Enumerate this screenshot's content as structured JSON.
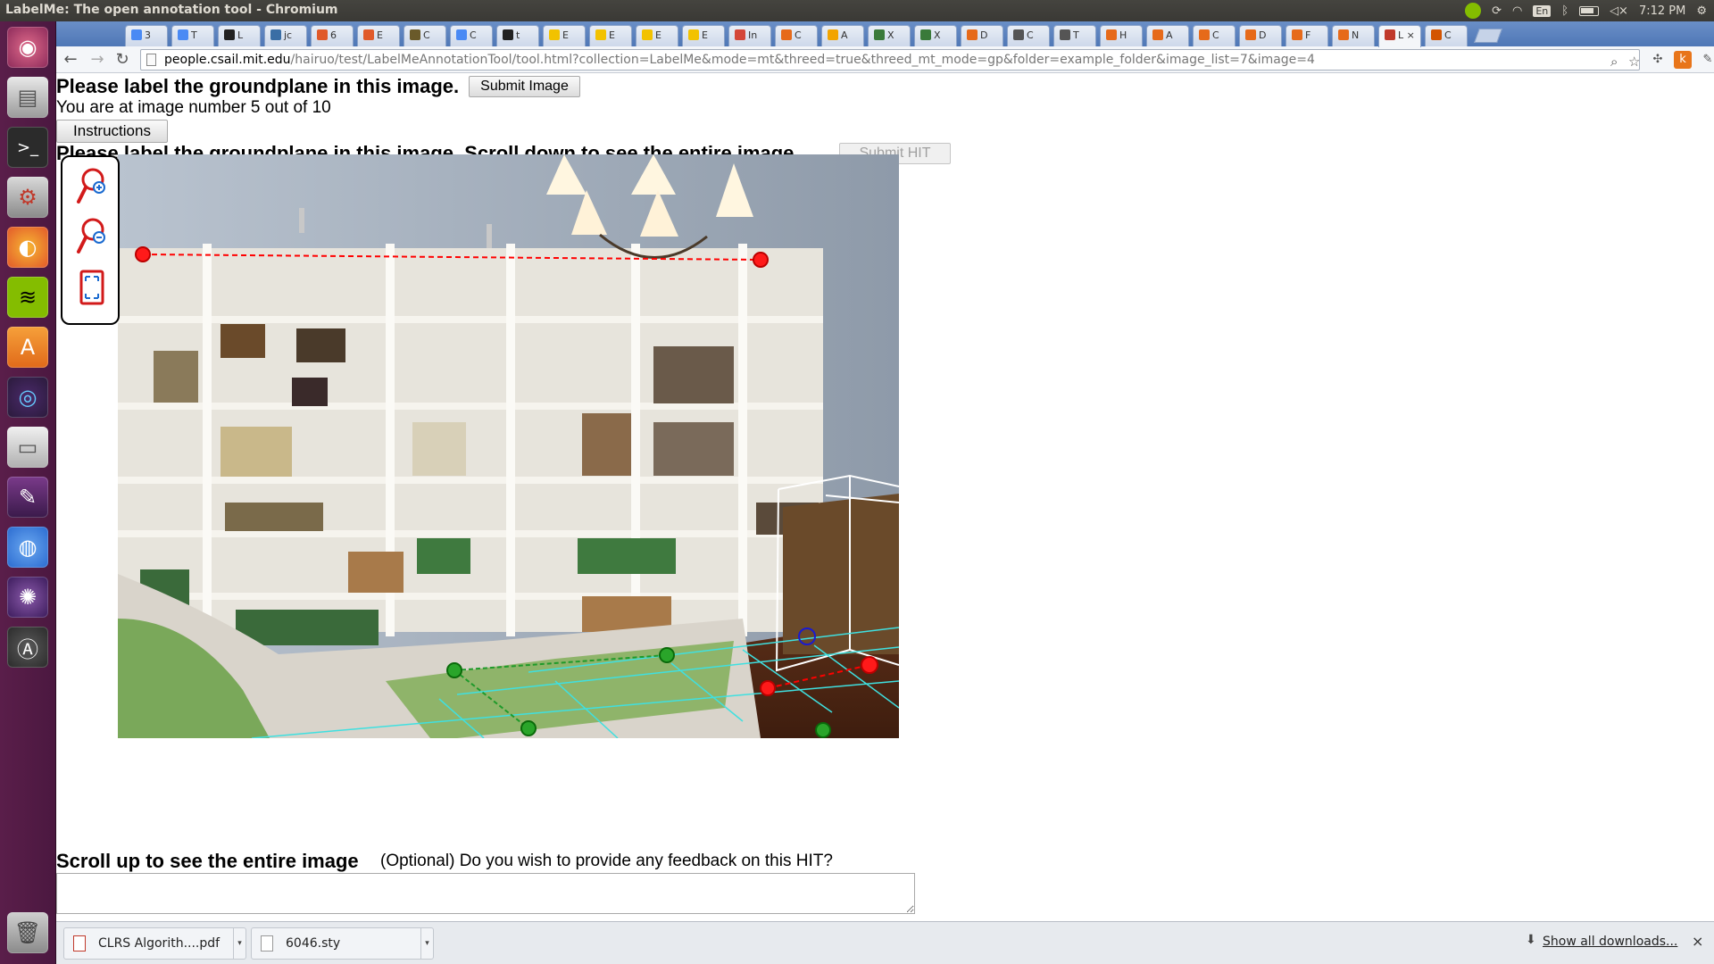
{
  "window": {
    "title": "LabelMe: The open annotation tool - Chromium"
  },
  "tray": {
    "lang": "En",
    "time": "7:12 PM"
  },
  "tabs": [
    {
      "label": "3",
      "color": "#4a8af4"
    },
    {
      "label": "T",
      "color": "#4a8af4"
    },
    {
      "label": "L",
      "color": "#222222"
    },
    {
      "label": "jc",
      "color": "#3a6ea5"
    },
    {
      "label": "6",
      "color": "#e05a2a"
    },
    {
      "label": "E",
      "color": "#e05a2a"
    },
    {
      "label": "C",
      "color": "#6a5a2a"
    },
    {
      "label": "C",
      "color": "#4a8af4"
    },
    {
      "label": "t",
      "color": "#222222"
    },
    {
      "label": "E",
      "color": "#f2c200"
    },
    {
      "label": "E",
      "color": "#f2c200"
    },
    {
      "label": "E",
      "color": "#f2c200"
    },
    {
      "label": "E",
      "color": "#f2c200"
    },
    {
      "label": "In",
      "color": "#d44638"
    },
    {
      "label": "C",
      "color": "#e66a1a"
    },
    {
      "label": "A",
      "color": "#f2a400"
    },
    {
      "label": "X",
      "color": "#3a7a3a"
    },
    {
      "label": "X",
      "color": "#3a7a3a"
    },
    {
      "label": "D",
      "color": "#e66a1a"
    },
    {
      "label": "C",
      "color": "#555555"
    },
    {
      "label": "T",
      "color": "#555555"
    },
    {
      "label": "H",
      "color": "#e66a1a"
    },
    {
      "label": "A",
      "color": "#e66a1a"
    },
    {
      "label": "C",
      "color": "#e66a1a"
    },
    {
      "label": "D",
      "color": "#e66a1a"
    },
    {
      "label": "F",
      "color": "#e66a1a"
    },
    {
      "label": "N",
      "color": "#e66a1a"
    },
    {
      "label": "L",
      "color": "#c0392b",
      "active": true
    },
    {
      "label": "C",
      "color": "#d35400"
    }
  ],
  "toolbar": {
    "url_host": "people.csail.mit.edu",
    "url_path": "/hairuo/test/LabelMeAnnotationTool/tool.html?collection=LabelMe&mode=mt&threed=true&threed_mt_mode=gp&folder=example_folder&image_list=7&image=4"
  },
  "page": {
    "prompt_top": "Please label the groundplane in this image.",
    "submit_image_label": "Submit Image",
    "progress_text": "You are at image number 5 out of 10",
    "instructions_label": "Instructions",
    "prompt_hidden": "Please label the groundplane in this image. Scroll down to see the entire image.",
    "submit_hit_label": "Submit HIT",
    "scroll_up_text": "Scroll up to see the entire image",
    "feedback_prompt": "(Optional) Do you wish to provide any feedback on this HIT?"
  },
  "downloads": {
    "items": [
      {
        "name": "CLRS Algorith....pdf"
      },
      {
        "name": "6046.sty"
      }
    ],
    "show_all": "Show all downloads...",
    "close": "×"
  },
  "colors": {
    "launcher": "#5a1e4a",
    "tabstrip": "#5f83bf",
    "annotation_red": "#ff0000",
    "annotation_green": "#1f9a2a",
    "annotation_cyan": "#3fe0e0",
    "annotation_blue": "#1a1ad0"
  }
}
